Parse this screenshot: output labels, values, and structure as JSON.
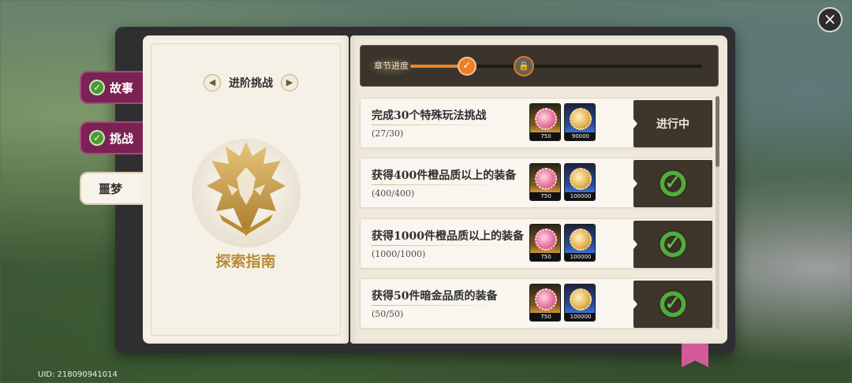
{
  "close_icon": "×",
  "side_tabs": [
    {
      "label": "故事",
      "done": true
    },
    {
      "label": "挑战",
      "done": true
    },
    {
      "label": "噩梦",
      "done": false
    }
  ],
  "left_page": {
    "title": "进阶挑战",
    "prev_icon": "◀",
    "next_icon": "▶",
    "caption": "探索指南",
    "emblem": "golden-dragon-crest-icon"
  },
  "chapter_progress": {
    "label": "章节进度",
    "fraction": 0.2,
    "done_icon": "✓",
    "lock_icon": "🔒"
  },
  "tasks": [
    {
      "title": "完成30个特殊玩法挑战",
      "progress": "(27/30)",
      "rewards": [
        {
          "qty": "750",
          "type": "pink"
        },
        {
          "qty": "90000",
          "type": "gold"
        }
      ],
      "status": "进行中",
      "completed": false
    },
    {
      "title": "获得400件橙品质以上的装备",
      "progress": "(400/400)",
      "rewards": [
        {
          "qty": "750",
          "type": "pink"
        },
        {
          "qty": "100000",
          "type": "gold"
        }
      ],
      "status": "",
      "completed": true
    },
    {
      "title": "获得1000件橙品质以上的装备",
      "progress": "(1000/1000)",
      "rewards": [
        {
          "qty": "750",
          "type": "pink"
        },
        {
          "qty": "100000",
          "type": "gold"
        }
      ],
      "status": "",
      "completed": true
    },
    {
      "title": "获得50件暗金品质的装备",
      "progress": "(50/50)",
      "rewards": [
        {
          "qty": "750",
          "type": "pink"
        },
        {
          "qty": "100000",
          "type": "gold"
        }
      ],
      "status": "",
      "completed": true
    }
  ],
  "check_icon": "✓",
  "uid": "UID: 218090941014"
}
